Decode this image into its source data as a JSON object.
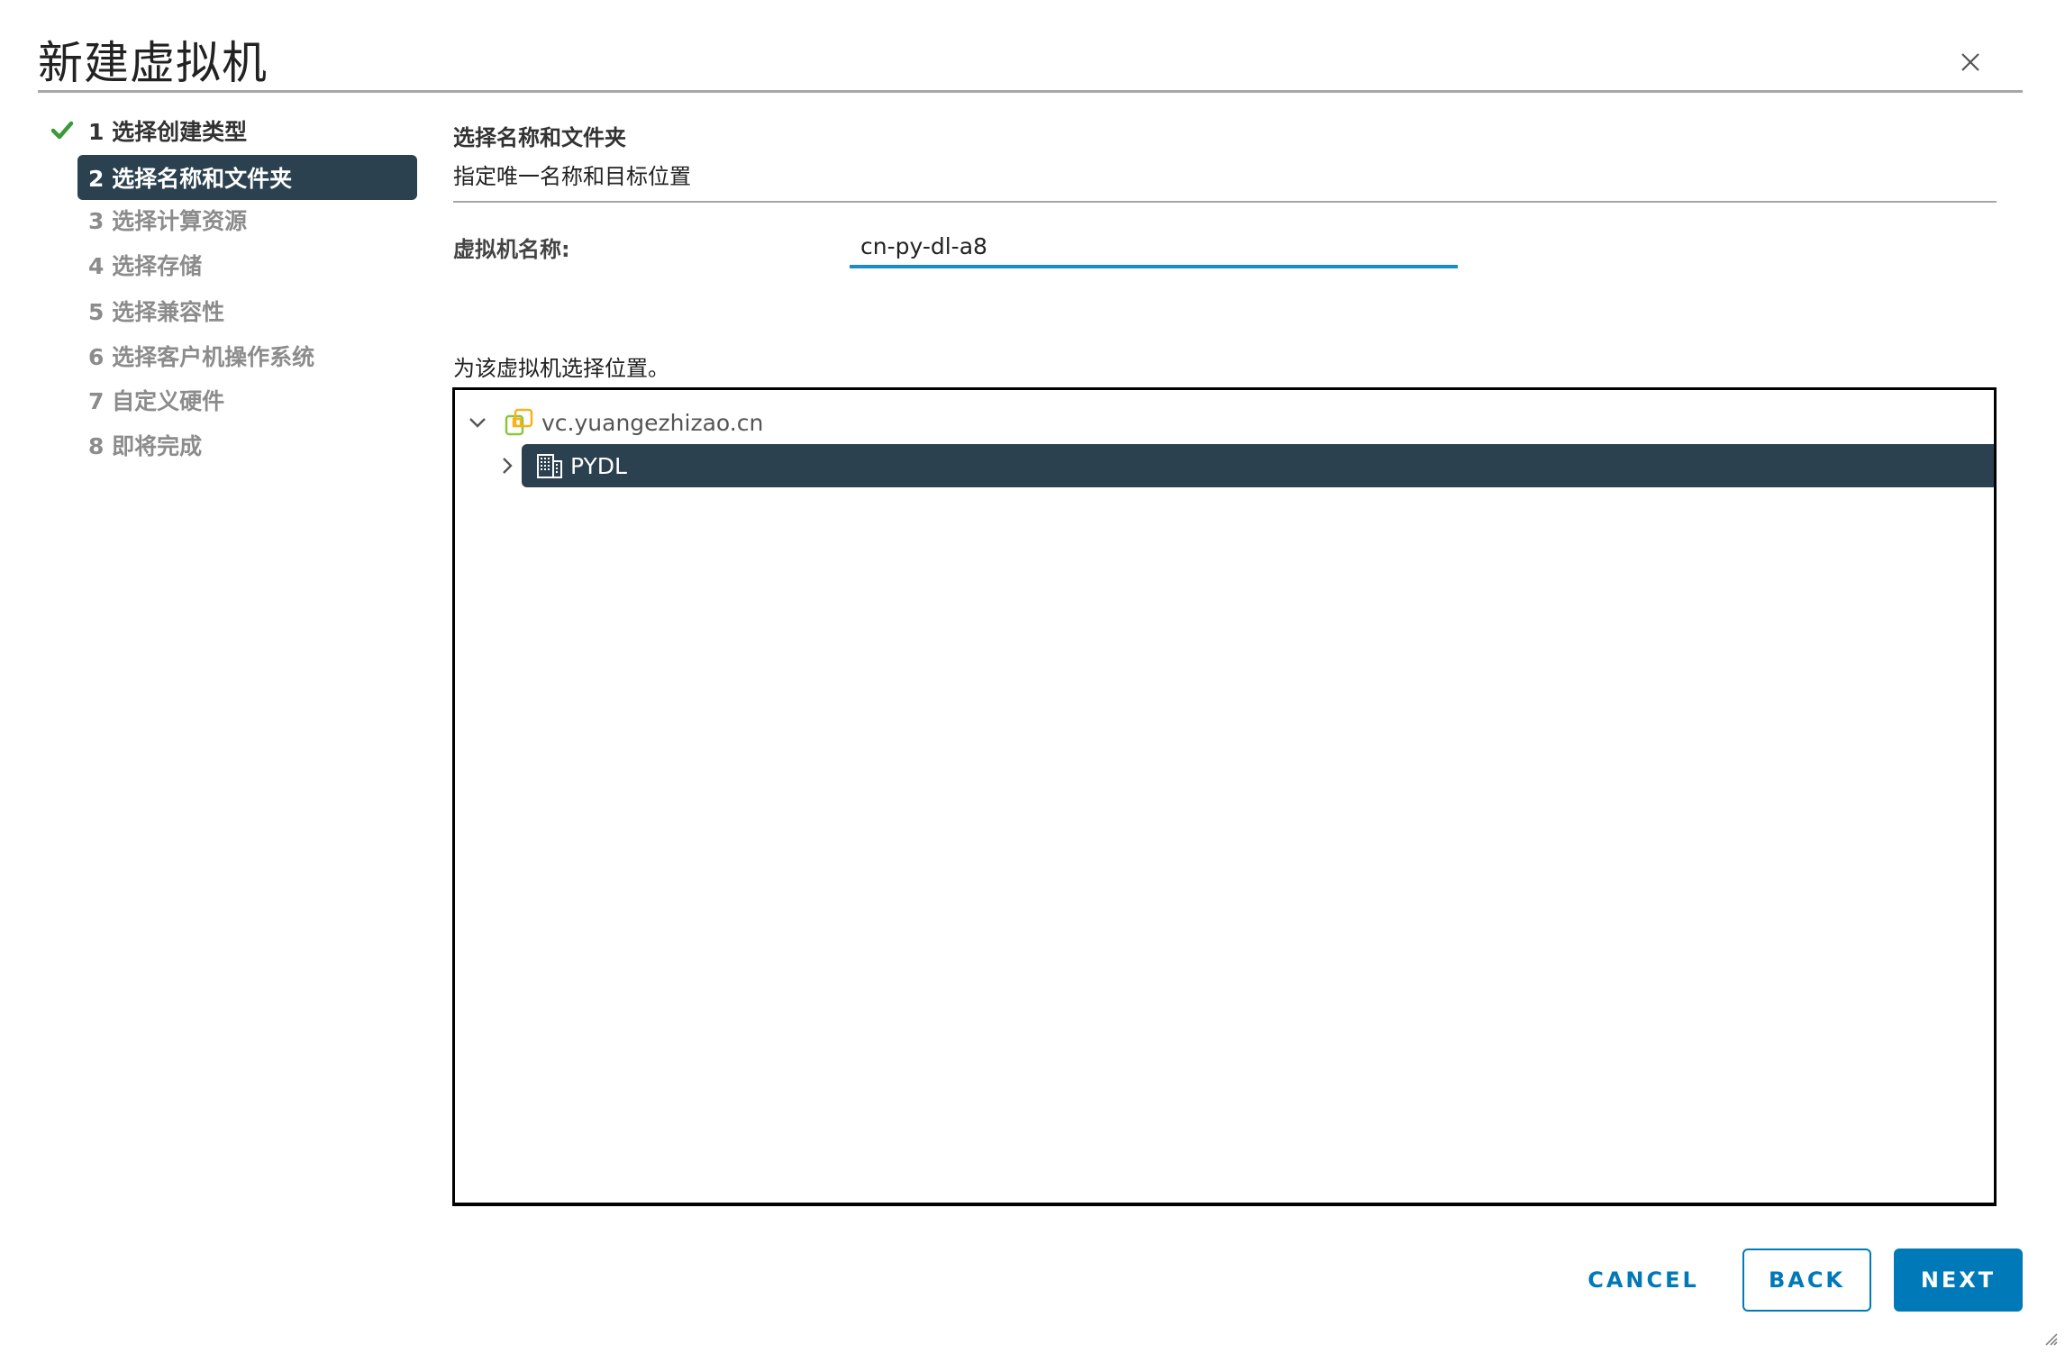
{
  "dialog": {
    "title": "新建虚拟机",
    "close_icon": "close-icon"
  },
  "steps": [
    {
      "label": "1 选择创建类型",
      "state": "done"
    },
    {
      "label": "2 选择名称和文件夹",
      "state": "active"
    },
    {
      "label": "3 选择计算资源",
      "state": "pending"
    },
    {
      "label": "4 选择存储",
      "state": "pending"
    },
    {
      "label": "5 选择兼容性",
      "state": "pending"
    },
    {
      "label": "6 选择客户机操作系统",
      "state": "pending"
    },
    {
      "label": "7 自定义硬件",
      "state": "pending"
    },
    {
      "label": "8 即将完成",
      "state": "pending"
    }
  ],
  "content": {
    "section_title": "选择名称和文件夹",
    "section_subtitle": "指定唯一名称和目标位置",
    "name_label": "虚拟机名称:",
    "name_value": "cn-py-dl-a8",
    "location_label": "为该虚拟机选择位置。"
  },
  "tree": {
    "root": {
      "label": "vc.yuangezhizao.cn",
      "expanded": true,
      "icon": "vcenter-icon"
    },
    "children": [
      {
        "label": "PYDL",
        "expanded": false,
        "selected": true,
        "icon": "datacenter-icon"
      }
    ]
  },
  "footer": {
    "cancel_label": "CANCEL",
    "back_label": "BACK",
    "next_label": "NEXT"
  },
  "colors": {
    "accent": "#0079b8",
    "selected_bg": "#2b4150",
    "input_underline": "#1a8ccc",
    "check": "#3c9a3c"
  }
}
